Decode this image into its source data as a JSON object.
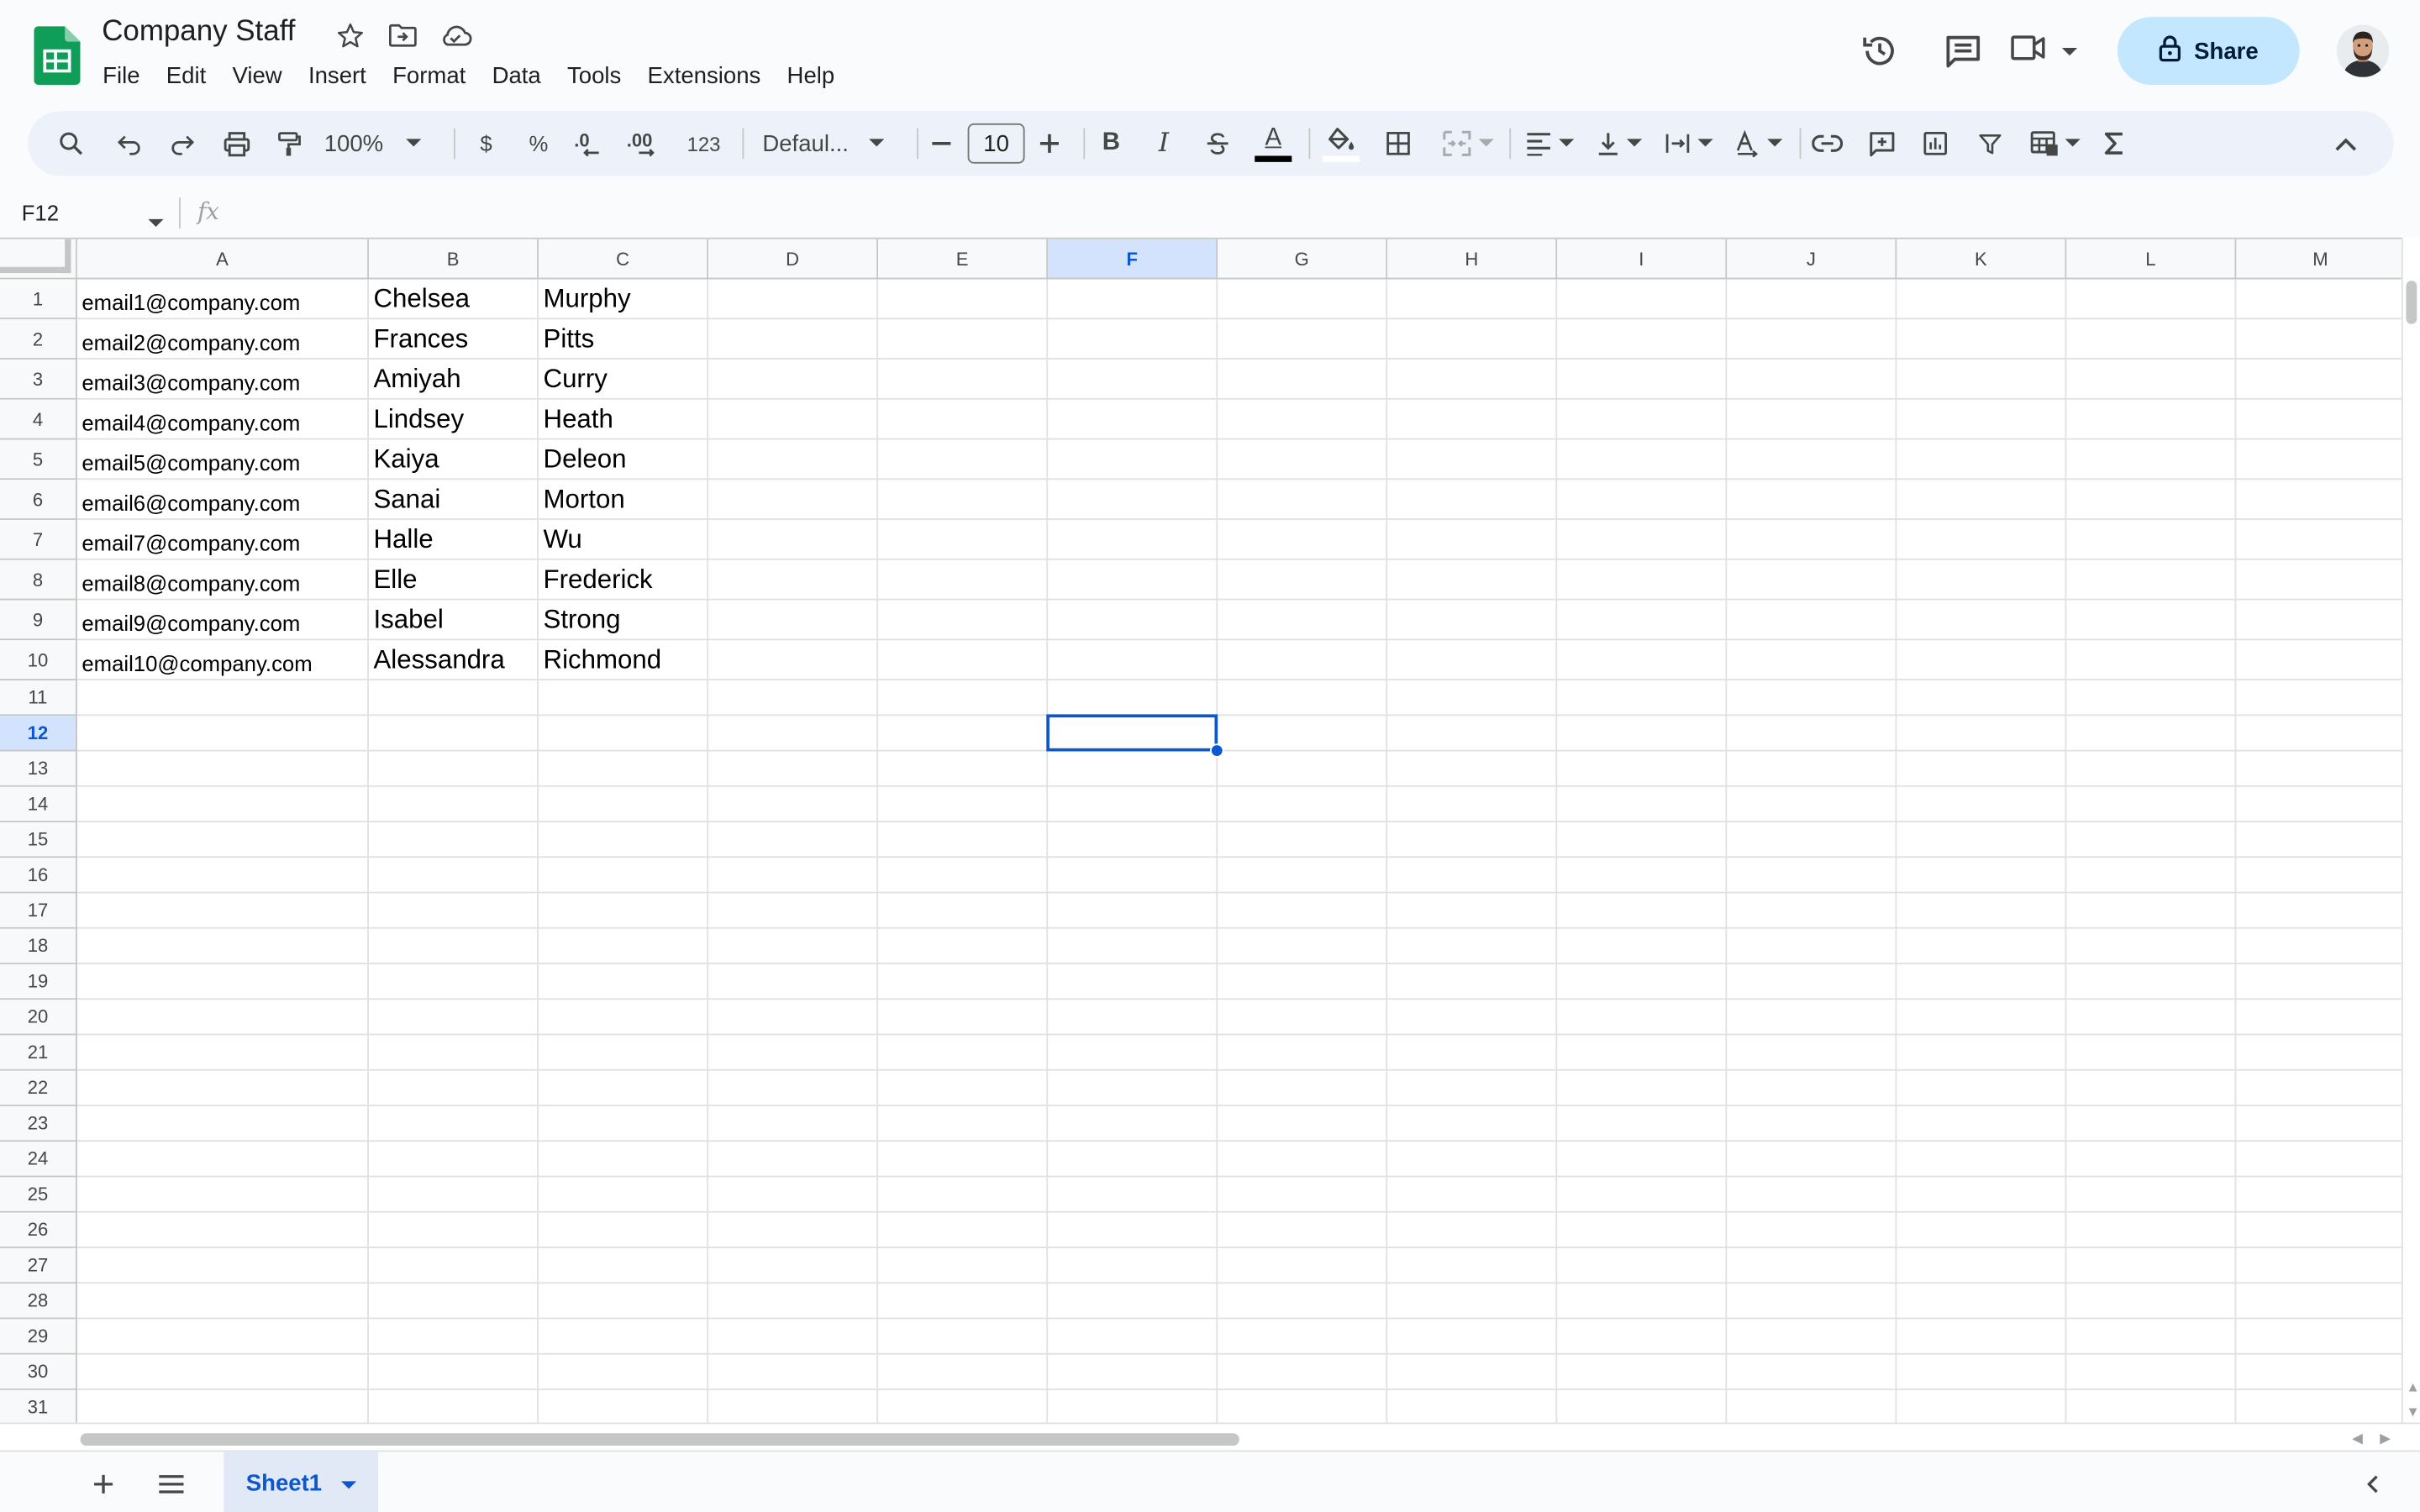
{
  "app": {
    "document_title": "Company Staff",
    "brand_color": "#0f9d58",
    "accent_color": "#0b57d0"
  },
  "menubar": {
    "items": [
      "File",
      "Edit",
      "View",
      "Insert",
      "Format",
      "Data",
      "Tools",
      "Extensions",
      "Help"
    ]
  },
  "header": {
    "share_label": "Share",
    "icons": [
      "star-icon",
      "move-to-folder-icon",
      "cloud-saved-icon",
      "version-history-icon",
      "comments-icon",
      "meet-icon",
      "lock-icon"
    ]
  },
  "toolbar": {
    "zoom": "100%",
    "currency_label": "$",
    "percent_label": "%",
    "decrease_decimal_label": ".0",
    "increase_decimal_label": ".00",
    "more_formats_label": "123",
    "font_name": "Defaul...",
    "font_size": "10",
    "bold_label": "B",
    "italic_label": "I",
    "text_color_label": "A"
  },
  "formula_bar": {
    "name_box": "F12",
    "fx_label": "fx",
    "formula": ""
  },
  "grid": {
    "columns": [
      "A",
      "B",
      "C",
      "D",
      "E",
      "F",
      "G",
      "H",
      "I",
      "J",
      "K",
      "L",
      "M"
    ],
    "selected_column": "F",
    "row_numbers": [
      "1",
      "2",
      "3",
      "4",
      "5",
      "6",
      "7",
      "8",
      "9",
      "10",
      "11",
      "12",
      "13",
      "14",
      "15",
      "16",
      "17",
      "18",
      "19",
      "20",
      "21",
      "22",
      "23",
      "24",
      "25",
      "26",
      "27",
      "28",
      "29",
      "30",
      "31"
    ],
    "selected_row": "12",
    "selected_cell": "F12",
    "rows": [
      [
        "email1@company.com",
        "Chelsea",
        "Murphy"
      ],
      [
        "email2@company.com",
        "Frances",
        "Pitts"
      ],
      [
        "email3@company.com",
        "Amiyah",
        "Curry"
      ],
      [
        "email4@company.com",
        "Lindsey",
        "Heath"
      ],
      [
        "email5@company.com",
        "Kaiya",
        "Deleon"
      ],
      [
        "email6@company.com",
        "Sanai",
        "Morton"
      ],
      [
        "email7@company.com",
        "Halle",
        "Wu"
      ],
      [
        "email8@company.com",
        "Elle",
        "Frederick"
      ],
      [
        "email9@company.com",
        "Isabel",
        "Strong"
      ],
      [
        "email10@company.com",
        "Alessandra",
        "Richmond"
      ]
    ]
  },
  "sheets": {
    "tabs": [
      "Sheet1"
    ],
    "active": "Sheet1"
  }
}
